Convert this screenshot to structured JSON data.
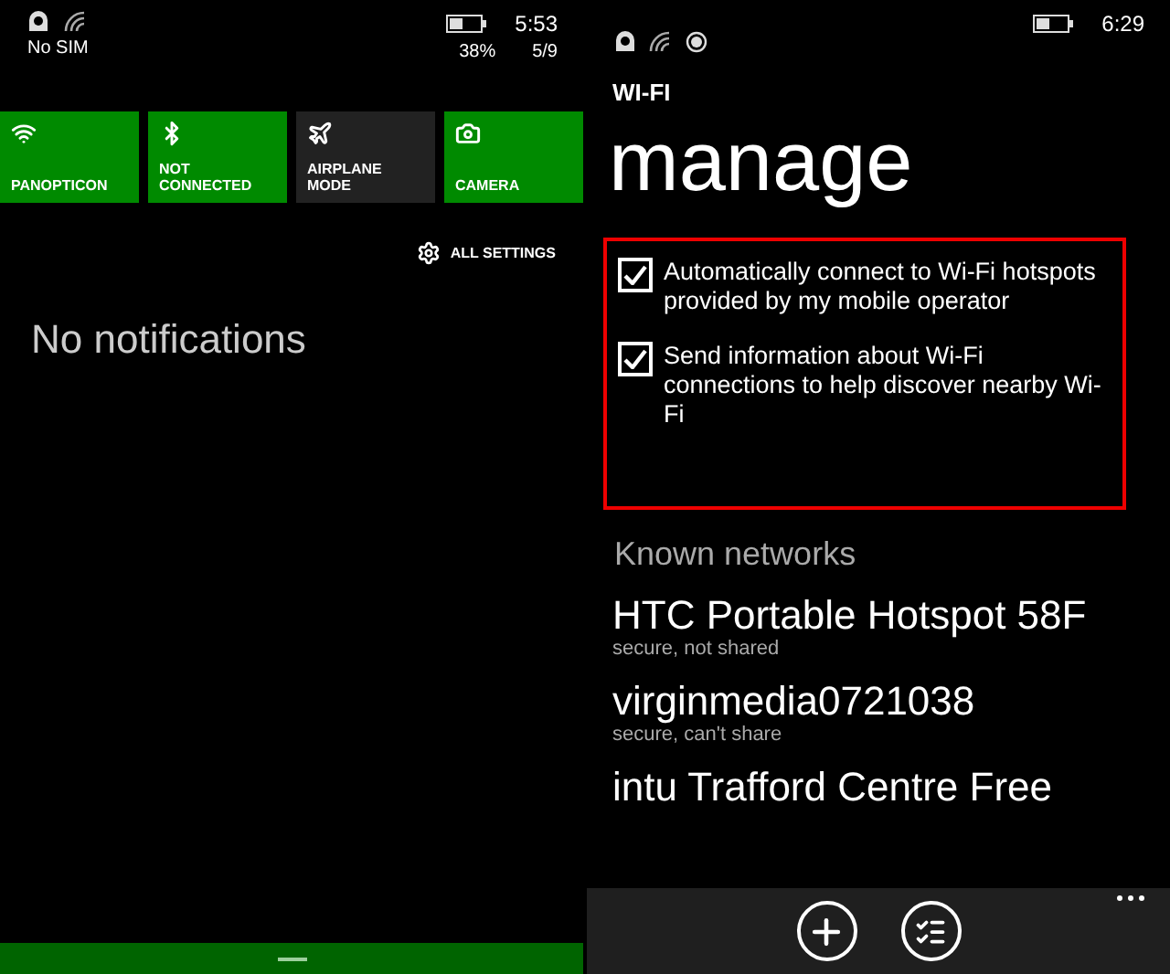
{
  "left_screen": {
    "status_bar": {
      "carrier": "No SIM",
      "time": "5:53",
      "battery_percent": "38%",
      "date": "5/9"
    },
    "quick_actions": [
      {
        "kind": "wifi",
        "label": "PANOPTICON",
        "on": true
      },
      {
        "kind": "bluetooth",
        "label": "NOT CONNECTED",
        "on": true
      },
      {
        "kind": "airplane",
        "label": "AIRPLANE MODE",
        "on": false
      },
      {
        "kind": "camera",
        "label": "CAMERA",
        "on": true
      }
    ],
    "all_settings": "ALL SETTINGS",
    "notifications": "No notifications"
  },
  "right_screen": {
    "status_bar": {
      "time": "6:29"
    },
    "app_title": "WI-FI",
    "page_title": "manage",
    "options": [
      {
        "label": "Automatically connect to Wi-Fi hotspots provided by my mobile operator",
        "checked": true
      },
      {
        "label": "Send information about Wi-Fi connections to help discover nearby Wi-Fi",
        "checked": true
      }
    ],
    "known_networks_heading": "Known networks",
    "networks": [
      {
        "name": "HTC Portable Hotspot 58F",
        "status": "secure, not shared"
      },
      {
        "name": "virginmedia0721038",
        "status": "secure, can't share"
      },
      {
        "name": "intu Trafford Centre Free"
      }
    ],
    "app_bar": {
      "buttons": [
        {
          "kind": "add"
        },
        {
          "kind": "list"
        }
      ]
    }
  }
}
